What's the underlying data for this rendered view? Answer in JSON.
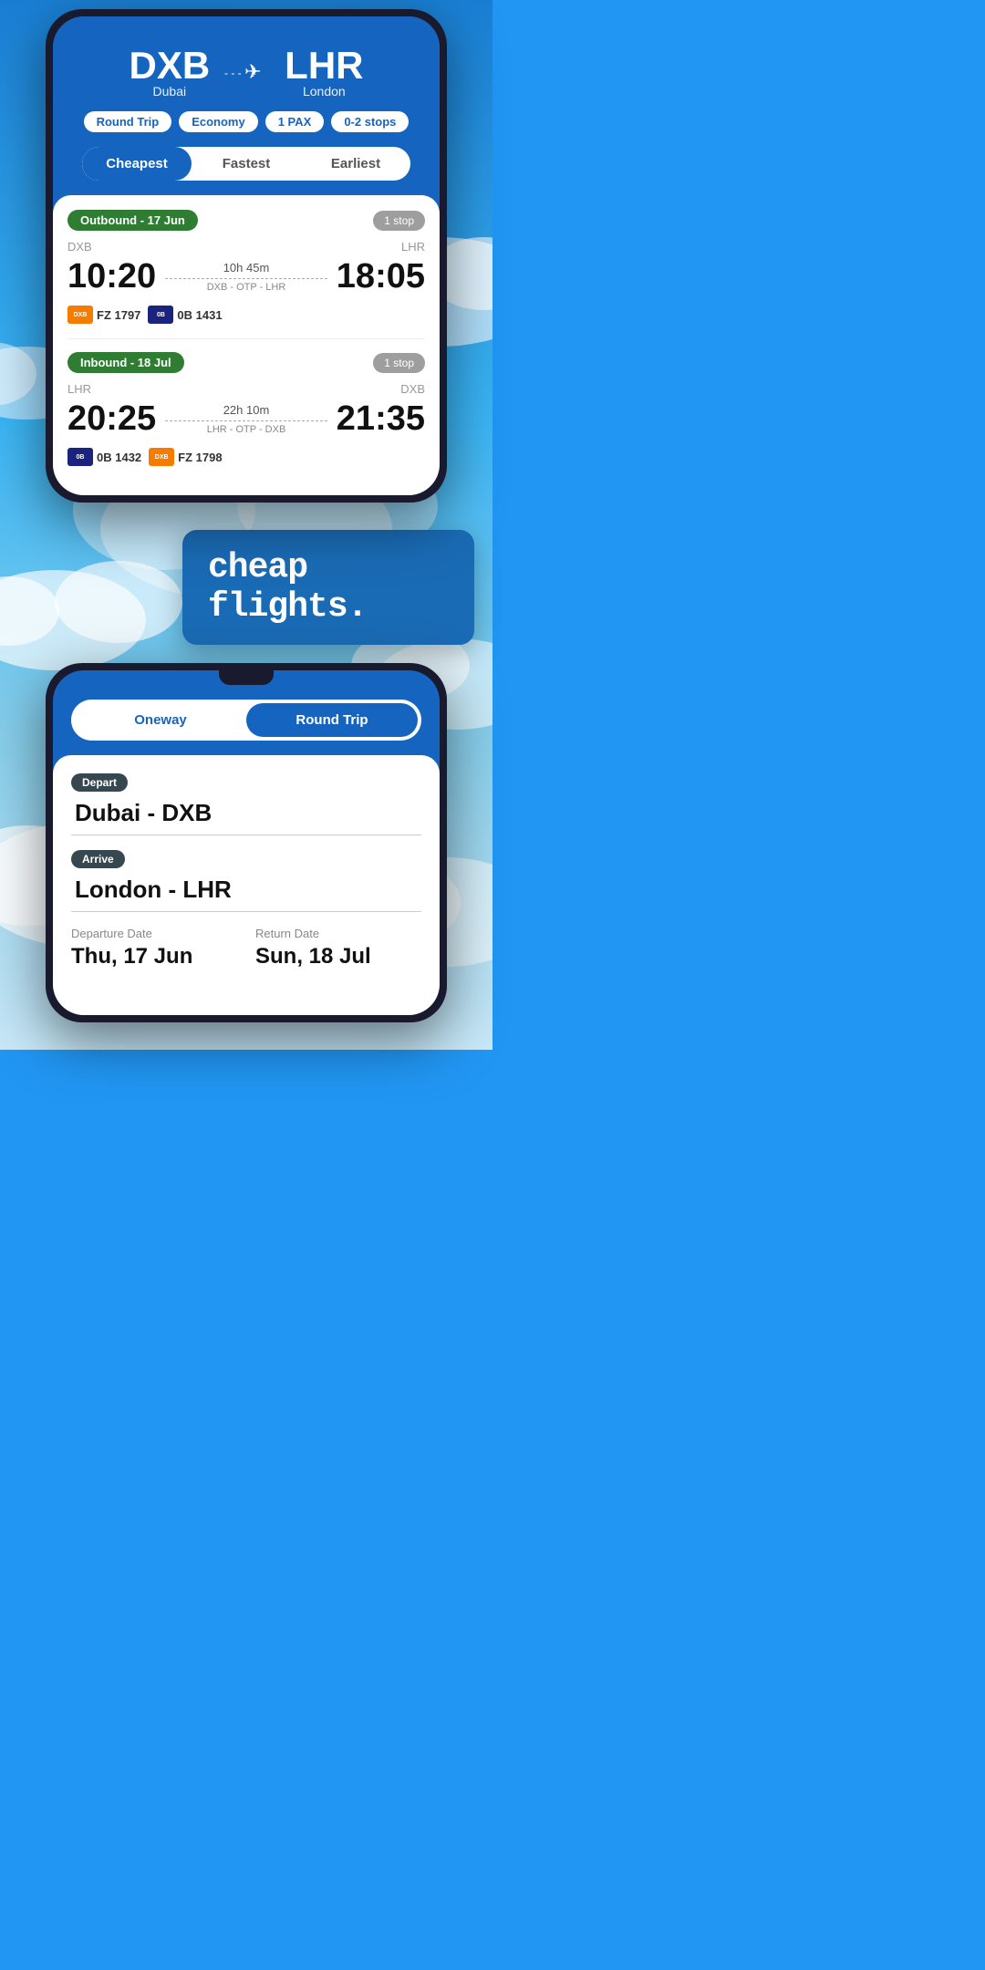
{
  "phone1": {
    "origin_code": "DXB",
    "origin_city": "Dubai",
    "destination_code": "LHR",
    "destination_city": "London",
    "tags": [
      "Round Trip",
      "Economy",
      "1 PAX",
      "0-2 stops"
    ],
    "tabs": [
      "Cheapest",
      "Fastest",
      "Earliest"
    ],
    "active_tab": "Cheapest",
    "outbound": {
      "label": "Outbound - 17 Jun",
      "stops": "1 stop",
      "from": "DXB",
      "to": "LHR",
      "depart_time": "10:20",
      "arrive_time": "18:05",
      "duration": "10h 45m",
      "route": "DXB - OTP - LHR",
      "airlines": [
        {
          "code": "FZ 1797",
          "color": "orange"
        },
        {
          "code": "0B 1431",
          "color": "blue"
        }
      ]
    },
    "inbound": {
      "label": "Inbound - 18 Jul",
      "stops": "1 stop",
      "from": "LHR",
      "to": "DXB",
      "depart_time": "20:25",
      "arrive_time": "21:35",
      "duration": "22h 10m",
      "route": "LHR - OTP - DXB",
      "airlines": [
        {
          "code": "0B 1432",
          "color": "blue"
        },
        {
          "code": "FZ 1798",
          "color": "orange"
        }
      ]
    }
  },
  "headline": "cheap flights.",
  "phone2": {
    "trip_options": [
      "Oneway",
      "Round Trip"
    ],
    "active_trip": "Round Trip",
    "depart_label": "Depart",
    "depart_value": "Dubai - DXB",
    "arrive_label": "Arrive",
    "arrive_value": "London - LHR",
    "departure_date_label": "Departure Date",
    "departure_date_value": "Thu, 17 Jun",
    "return_date_label": "Return Date",
    "return_date_value": "Sun, 18 Jul"
  }
}
